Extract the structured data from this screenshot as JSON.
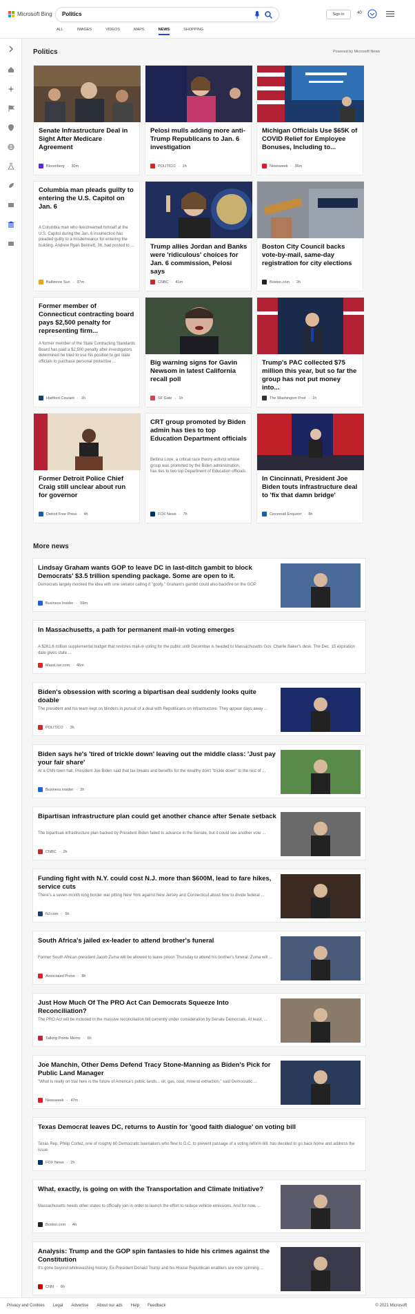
{
  "header": {
    "logo_text": "Microsoft Bing",
    "search_value": "Politics",
    "tabs": [
      "ALL",
      "IMAGES",
      "VIDEOS",
      "MAPS",
      "NEWS",
      "SHOPPING"
    ],
    "signin": "Sign in",
    "points": "40"
  },
  "section": {
    "title": "Politics",
    "powered": "Powered by Microsoft News"
  },
  "cards": [
    {
      "title": "Senate Infrastructure Deal in Sight After Medicare Agreement",
      "source": "Bloomberg",
      "time": "30m",
      "src_color": "#5b2bd6"
    },
    {
      "title": "Pelosi mulls adding more anti-Trump Republicans to Jan. 6 investigation",
      "source": "POLITICO",
      "time": "1h",
      "src_color": "#d9262b"
    },
    {
      "title": "Michigan Officials Use $65K of COVID Relief for Employee Bonuses, Including to...",
      "source": "Newsweek",
      "time": "36m",
      "src_color": "#e31b23"
    },
    {
      "title": "Columbia man pleads guilty to entering the U.S. Capitol on Jan. 6",
      "snippet": "A Columbia man who livestreamed himself at the U.S. Capitol during the Jan. 6 insurrection has pleaded guilty to a misdemeanor for entering the building. Andrew Ryan Bennett, 36, had posted to ...",
      "source": "Baltimore Sun",
      "time": "37m",
      "src_color": "#e5a514"
    },
    {
      "title": "Trump allies Jordan and Banks were 'ridiculous' choices for Jan. 6 commission, Pelosi says",
      "source": "CNBC",
      "time": "41m",
      "src_color": "#c9282d"
    },
    {
      "title": "Boston City Council backs vote-by-mail, same-day registration for city elections",
      "source": "Boston.com",
      "time": "2h",
      "src_color": "#222222"
    },
    {
      "title": "Former member of Connecticut contracting board pays $2,500 penalty for representing firm...",
      "snippet": "A former member of the State Contracting Standards Board has paid a $2,500 penalty after investigators determined he tried to use his position to get state officials to purchase personal protective ...",
      "source": "Hartford Courant",
      "time": "1h",
      "src_color": "#1a3e6e"
    },
    {
      "title": "Big warning signs for Gavin Newsom in latest California recall poll",
      "source": "SF Gate",
      "time": "1h",
      "src_color": "#d4464d"
    },
    {
      "title": "Trump's PAC collected $75 million this year, but so far the group has not put money into...",
      "source": "The Washington Post",
      "time": "1h",
      "src_color": "#333333"
    },
    {
      "title": "Former Detroit Police Chief Craig still unclear about run for governor",
      "source": "Detroit Free Press",
      "time": "4h",
      "src_color": "#1a5da8"
    },
    {
      "title": "CRT group promoted by Biden admin has ties to top Education Department officials",
      "snippet": "Bettina Love, a critical race theory activist whose group was promoted by the Biden administration, has ties to two top Department of Education officials.",
      "source": "FOX News",
      "time": "7h",
      "src_color": "#003366"
    },
    {
      "title": "In Cincinnati, President Joe Biden touts infrastructure deal to 'fix that damn bridge'",
      "source": "Cincinnati Enquirer",
      "time": "8h",
      "src_color": "#1a5da8"
    }
  ],
  "more_news": {
    "title": "More news",
    "items": [
      {
        "title": "Lindsay Graham wants GOP to leave DC in last-ditch gambit to block Democrats' $3.5 trillion spending package. Some are open to it.",
        "snippet": "Democrats largely mocked the idea with one senator calling it \"goofy.\" Graham's gambit could also backfire on the GOP.",
        "source": "Business Insider",
        "time": "59m",
        "src_color": "#1a62e0",
        "image": true
      },
      {
        "title": "In Massachusetts, a path for permanent mail-in voting emerges",
        "snippet": "A $261.6 million supplemental budget that restores mail-in voting for the public until December is headed to Massachusetts Gov. Charlie Baker's desk. The Dec. 15 expiration date gives state ...",
        "source": "MassLive.com",
        "time": "46m",
        "src_color": "#d9262b",
        "image": false
      },
      {
        "title": "Biden's obsession with scoring a bipartisan deal suddenly looks quite doable",
        "snippet": "The president and his team kept on blinders in pursuit of a deal with Republicans on infrastructure. They appear days away ...",
        "source": "POLITICO",
        "time": "3h",
        "src_color": "#d9262b",
        "image": true
      },
      {
        "title": "Biden says he's 'tired of trickle down' leaving out the middle class: 'Just pay your fair share'",
        "snippet": "At a CNN town hall, President Joe Biden said that tax breaks and benefits for the wealthy don't \"trickle down\" to the rest of ...",
        "source": "Business Insider",
        "time": "2h",
        "src_color": "#1a62e0",
        "image": true
      },
      {
        "title": "Bipartisan infrastructure plan could get another chance after Senate setback",
        "snippet": "The bipartisan infrastructure plan backed by President Biden failed to advance in the Senate, but it could see another vote ...",
        "source": "CNBC",
        "time": "2h",
        "src_color": "#c9282d",
        "image": true
      },
      {
        "title": "Funding fight with N.Y. could cost N.J. more than $600M, lead to fare hikes, service cuts",
        "snippet": "There's a seven-month long border war pitting New York against New Jersey and Connecticut about how to divide federal ...",
        "source": "NJ.com",
        "time": "5h",
        "src_color": "#1a3e6e",
        "image": true
      },
      {
        "title": "South Africa's jailed ex-leader to attend brother's funeral",
        "snippet": "Former South African president Jacob Zuma will be allowed to leave prison Thursday to attend his brother's funeral. Zuma will ...",
        "source": "Associated Press",
        "time": "8h",
        "src_color": "#d9262b",
        "image": true
      },
      {
        "title": "Just How Much Of The PRO Act Can Democrats Squeeze Into Reconciliation?",
        "snippet": "The PRO Act will be included in the massive reconciliation bill currently under consideration by Senate Democrats. At least, ...",
        "source": "Talking Points Memo",
        "time": "6h",
        "src_color": "#c2252c",
        "image": true
      },
      {
        "title": "Joe Manchin, Other Dems Defend Tracy Stone-Manning as Biden's Pick for Public Land Manager",
        "snippet": "\"What is really on trial here is the future of America's public lands... oil, gas, coal, mineral extraction,\" said Democratic ...",
        "source": "Newsweek",
        "time": "47m",
        "src_color": "#e31b23",
        "image": true
      },
      {
        "title": "Texas Democrat leaves DC, returns to Austin for 'good faith dialogue' on voting bill",
        "snippet": "Texas Rep. Philip Cortez, one of roughly 60 Democratic lawmakers who flew to D.C. to prevent passage of a voting reform bill, has decided to go back home and address the issue.",
        "source": "FOX News",
        "time": "2h",
        "src_color": "#003366",
        "image": false
      },
      {
        "title": "What, exactly, is going on with the Transportation and Climate Initiative?",
        "snippet": "Massachusetts needs other states to officially join in order to launch the effort to reduce vehicle emissions. And for now, ...",
        "source": "Boston.com",
        "time": "4h",
        "src_color": "#222222",
        "image": true
      },
      {
        "title": "Analysis: Trump and the GOP spin fantasies to hide his crimes against the Constitution",
        "snippet": "It's gone beyond whitewashing history. Ex-President Donald Trump and his House Republican enablers are now spinning ...",
        "source": "CNN",
        "time": "6h",
        "src_color": "#cc0000",
        "image": true
      }
    ]
  },
  "footer": {
    "links": [
      "Privacy and Cookies",
      "Legal",
      "Advertise",
      "About our ads",
      "Help",
      "Feedback"
    ],
    "copyright": "© 2021 Microsoft"
  }
}
